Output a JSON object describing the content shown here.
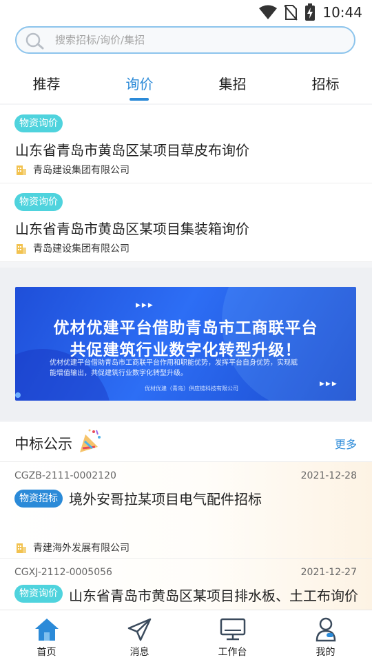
{
  "status": {
    "time": "10:44"
  },
  "search": {
    "placeholder": "搜索招标/询价/集招"
  },
  "tabs": [
    {
      "label": "推荐"
    },
    {
      "label": "询价"
    },
    {
      "label": "集招"
    },
    {
      "label": "招标"
    }
  ],
  "active_tab": "询价",
  "inquiries": [
    {
      "badge": "物资询价",
      "title": "山东省青岛市黄岛区某项目草皮布询价",
      "company": "青岛建设集团有限公司"
    },
    {
      "badge": "物资询价",
      "title": "山东省青岛市黄岛区某项目集装箱询价",
      "company": "青岛建设集团有限公司"
    }
  ],
  "banner": {
    "line1": "优材优建平台借助青岛市工商联平台",
    "line2": "共促建筑行业数字化转型升级！",
    "desc": "优材优建平台借助青岛市工商联平台作用和职能优势，发挥平台自身优势，实现赋能增值输出，共促建筑行业数字化转型升级。",
    "footer": "优材优建（青岛）供应链科技有限公司"
  },
  "awards": {
    "title": "中标公示",
    "more": "更多",
    "items": [
      {
        "code": "CGZB-2111-0002120",
        "date": "2021-12-28",
        "badge": "物资招标",
        "title": "境外安哥拉某项目电气配件招标",
        "company": "青建海外发展有限公司"
      },
      {
        "code": "CGXJ-2112-0005056",
        "date": "2021-12-27",
        "badge": "物资询价",
        "title": "山东省青岛市黄岛区某项目排水板、土工布询价"
      }
    ]
  },
  "bottom_nav": [
    {
      "label": "首页",
      "icon": "home-icon"
    },
    {
      "label": "消息",
      "icon": "paper-plane-icon"
    },
    {
      "label": "工作台",
      "icon": "monitor-icon"
    },
    {
      "label": "我的",
      "icon": "user-icon"
    }
  ],
  "colors": {
    "accent": "#2b8ad8",
    "cyan_badge": "#4fd3dd",
    "banner_blue": "#2d6ef5"
  }
}
